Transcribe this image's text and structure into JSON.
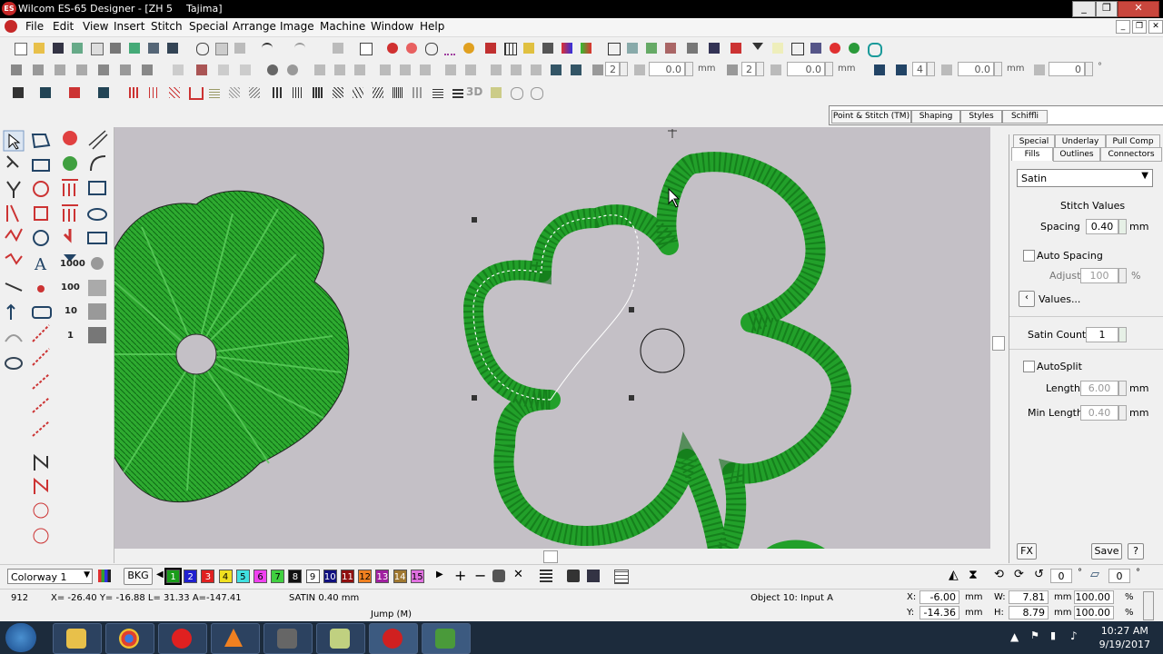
{
  "window": {
    "app_title": "Wilcom ES-65 Designer - [ZH 5",
    "doc_title": "Tajima]",
    "min": "_",
    "restore": "❐",
    "close": "✕"
  },
  "menu": [
    "File",
    "Edit",
    "View",
    "Insert",
    "Stitch",
    "Special",
    "Arrange",
    "Image",
    "Machine",
    "Window",
    "Help"
  ],
  "toolbar": {
    "field_a": "2",
    "field_b": "0.0",
    "field_c": "2",
    "field_d": "0.0",
    "field_e": "4",
    "field_f": "0.0",
    "field_g": "0",
    "unit": "mm",
    "threed": "3D"
  },
  "docker_tabs_top": [
    "Point & Stitch (TM)",
    "Shaping",
    "Styles",
    "Schiffli"
  ],
  "docker": {
    "tabs_row1": [
      "Special",
      "Underlay",
      "Pull Comp"
    ],
    "tabs_row2": [
      "Fills",
      "Outlines",
      "Connectors"
    ],
    "fill_type": "Satin",
    "stitch_values": "Stitch Values",
    "spacing_label": "Spacing",
    "spacing_value": "0.40",
    "unit_mm": "mm",
    "auto_spacing": "Auto Spacing",
    "adjust_label": "Adjust",
    "adjust_value": "100",
    "percent": "%",
    "values_link": "Values...",
    "satin_count_label": "Satin Count",
    "satin_count_value": "1",
    "autosplit": "AutoSplit",
    "length_label": "Length",
    "length_value": "6.00",
    "min_length_label": "Min Length",
    "min_length_value": "0.40",
    "fx": "FX",
    "save": "Save",
    "help": "?"
  },
  "palette": {
    "colorway": "Colorway 1",
    "bkg": "BKG",
    "swatches": [
      {
        "n": "1",
        "c": "#1a9c1a"
      },
      {
        "n": "2",
        "c": "#2020d0"
      },
      {
        "n": "3",
        "c": "#e02020"
      },
      {
        "n": "4",
        "c": "#f0e020"
      },
      {
        "n": "5",
        "c": "#40e0e0"
      },
      {
        "n": "6",
        "c": "#f040f0"
      },
      {
        "n": "7",
        "c": "#40d040"
      },
      {
        "n": "8",
        "c": "#111111"
      },
      {
        "n": "9",
        "c": "#ffffff"
      },
      {
        "n": "10",
        "c": "#101080"
      },
      {
        "n": "11",
        "c": "#901010"
      },
      {
        "n": "12",
        "c": "#f08020"
      },
      {
        "n": "13",
        "c": "#a020a0"
      },
      {
        "n": "14",
        "c": "#a07830"
      },
      {
        "n": "15",
        "c": "#e070e0"
      }
    ],
    "rot_value": "0",
    "slant_value": "0"
  },
  "status": {
    "stitch_no": "912",
    "coords": "X= -26.40 Y= -16.88 L=  31.33 A=-147.41",
    "stitch_type": "SATIN  0.40 mm",
    "object": "Object 10: Input A",
    "x_label": "X:",
    "x_value": "-6.00",
    "y_label": "Y:",
    "y_value": "-14.36",
    "w_label": "W:",
    "w_value": "7.81",
    "h_label": "H:",
    "h_value": "8.79",
    "mm": "mm",
    "pct_w": "100.00",
    "pct_h": "100.00",
    "pct": "%",
    "jump": "Jump (M)"
  },
  "taskbar": {
    "time": "10:27 AM",
    "date": "9/19/2017"
  },
  "colors": {
    "canvas": "#c4c0c6",
    "stitch_green": "#22a02a",
    "stitch_dark": "#0d6a14"
  }
}
